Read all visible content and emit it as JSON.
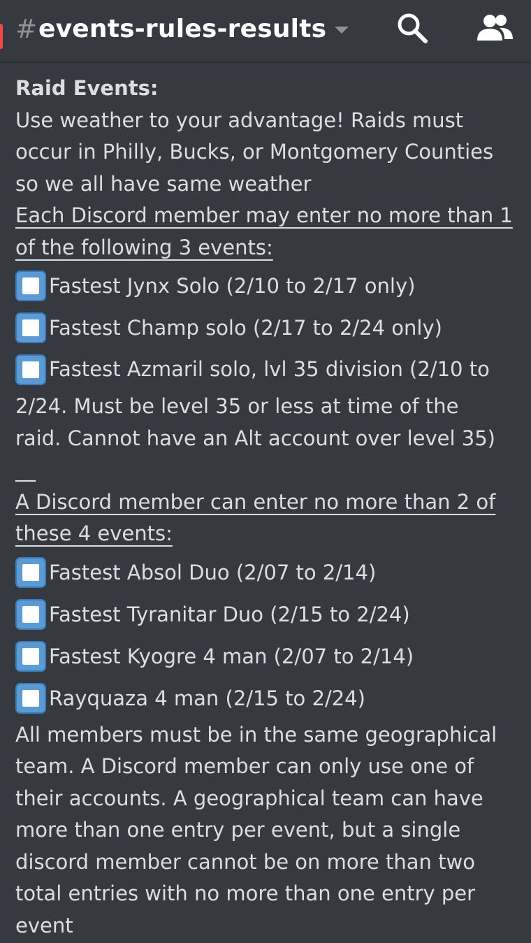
{
  "header": {
    "hash": "#",
    "channel_name": "events-rules-results",
    "icons": {
      "search": "search-icon",
      "members": "members-icon",
      "dropdown": "chevron-down-icon"
    },
    "unread_color": "#f04747"
  },
  "message": {
    "title": "Raid Events:",
    "intro": [
      "Use weather to your advantage! Raids must",
      "occur in Philly, Bucks, or Montgomery Counties",
      "so we all have same weather"
    ],
    "rule1": [
      "Each Discord member may enter no more than 1",
      "of the following 3 events:"
    ],
    "group1": [
      "Fastest Jynx Solo (2/10 to 2/17 only)",
      "Fastest Champ solo (2/17 to 2/24 only)"
    ],
    "group1_long": {
      "first": "Fastest Azmaril solo, lvl 35 division (2/10 to",
      "rest": [
        "2/24. Must be level 35 or less at time of the",
        "raid. Cannot have an Alt account over level 35)"
      ]
    },
    "separator": "__",
    "rule2": [
      "A Discord member can enter no more than 2 of",
      "these 4 events:"
    ],
    "group2": [
      "Fastest Absol Duo (2/07 to 2/14)",
      "Fastest Tyranitar Duo (2/15 to 2/24)",
      "Fastest Kyogre 4 man (2/07 to 2/14)",
      "Rayquaza 4 man (2/15 to 2/24)"
    ],
    "closing": [
      "All members must be in the same geographical",
      "team. A Discord member can only use one of",
      "their accounts. A geographical team can have",
      "more than one entry per event, but a single",
      "discord member cannot be on more than two",
      "total entries with no more than one entry per",
      "event"
    ],
    "checkbox_icon": "white-square-button-emoji"
  }
}
